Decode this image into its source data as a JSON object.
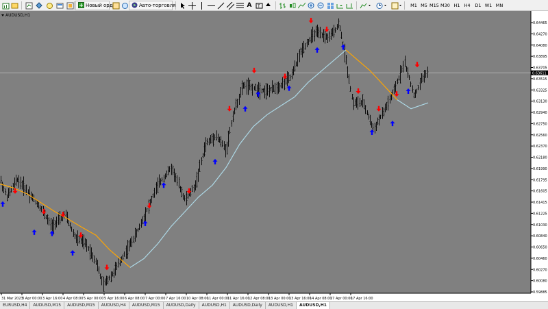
{
  "toolbar": {
    "new_order_label": "Новый ордер",
    "autotrading_label": "Авто-торговля",
    "timeframes": [
      "M1",
      "M5",
      "M15",
      "M30",
      "H1",
      "H4",
      "D1",
      "W1",
      "MN"
    ],
    "icons": [
      "new-chart-icon",
      "profiles-icon",
      "market-watch-icon",
      "data-window-icon",
      "navigator-icon",
      "terminal-icon",
      "strategy-tester-icon",
      "new-order-icon",
      "metaeditor-icon",
      "history-icon",
      "autotrading-icon",
      "cursor-icon",
      "crosshair-icon",
      "vertical-line-icon",
      "horizontal-line-icon",
      "trendline-icon",
      "equidistant-channel-icon",
      "fibonacci-icon",
      "text-icon",
      "text-label-icon",
      "arrows-icon",
      "bar-chart-icon",
      "candlesticks-icon",
      "line-chart-icon",
      "zoom-in-icon",
      "zoom-out-icon",
      "tile-windows-icon",
      "autoscroll-icon",
      "chart-shift-icon",
      "indicators-icon",
      "periods-icon",
      "templates-icon"
    ]
  },
  "chart": {
    "label": "AUDUSD,H1",
    "current_price": "0.63611",
    "background": "#808080",
    "bar_color": "#000000",
    "ma_fast_up_color": "#add8e6",
    "ma_fast_down_color": "#ffa500",
    "ma_slow_color": "#add8e6",
    "buy_arrow_color": "#0000ff",
    "sell_arrow_color": "#ff0000",
    "price_ticks": [
      "0.64465",
      "0.64270",
      "0.64080",
      "0.63895",
      "0.63705",
      "0.63515",
      "0.63325",
      "0.63130",
      "0.62940",
      "0.62750",
      "0.62560",
      "0.62370",
      "0.62180",
      "0.61990",
      "0.61795",
      "0.61605",
      "0.61415",
      "0.61225",
      "0.61030",
      "0.60840",
      "0.60650",
      "0.60460",
      "0.60270",
      "0.60080",
      "0.59885"
    ],
    "time_ticks": [
      "31 Mar 2023",
      "3 Apr 00:00",
      "3 Apr 16:00",
      "4 Apr 08:00",
      "5 Apr 00:00",
      "5 Apr 16:00",
      "6 Apr 08:00",
      "7 Apr 00:00",
      "7 Apr 16:00",
      "10 Apr 08:00",
      "11 Apr 00:00",
      "11 Apr 16:00",
      "12 Apr 08:00",
      "13 Apr 00:00",
      "13 Apr 16:00",
      "14 Apr 08:00",
      "17 Apr 00:00",
      "17 Apr 16:00"
    ]
  },
  "tabs": [
    {
      "label": "EURUSD,H4",
      "active": false
    },
    {
      "label": "AUDUSD,M15",
      "active": false
    },
    {
      "label": "AUDUSD,M15",
      "active": false
    },
    {
      "label": "AUDUSD,H4",
      "active": false
    },
    {
      "label": "AUDUSD,M15",
      "active": false
    },
    {
      "label": "AUDUSD,Daily",
      "active": false
    },
    {
      "label": "AUDUSD,H1",
      "active": false
    },
    {
      "label": "AUDUSD,Daily",
      "active": false
    },
    {
      "label": "AUDUSD,H1",
      "active": false
    },
    {
      "label": "AUDUSD,H1",
      "active": true
    }
  ]
}
